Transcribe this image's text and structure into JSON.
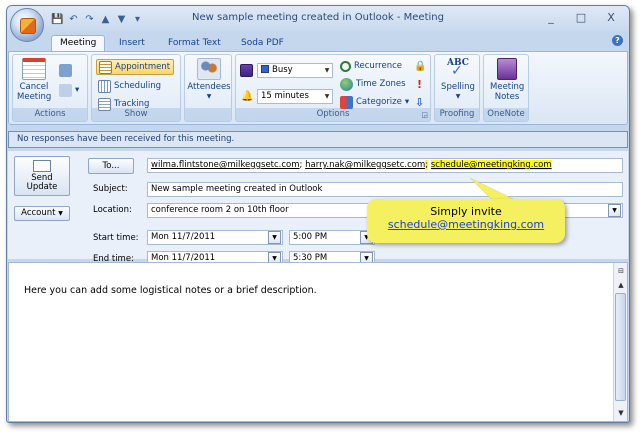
{
  "window": {
    "title": "New sample meeting created in Outlook - Meeting",
    "controls": [
      "_",
      "□",
      "X"
    ]
  },
  "tabs": [
    "Meeting",
    "Insert",
    "Format Text",
    "Soda PDF"
  ],
  "ribbon": {
    "actions": {
      "label": "Actions",
      "cancel": "Cancel Meeting"
    },
    "show": {
      "label": "Show",
      "appointment": "Appointment",
      "scheduling": "Scheduling",
      "tracking": "Tracking"
    },
    "attendees": {
      "label": "Attendees"
    },
    "options": {
      "label": "Options",
      "busy": "Busy",
      "reminder": "15 minutes",
      "recurrence": "Recurrence",
      "time_zones": "Time Zones",
      "categorize": "Categorize"
    },
    "proofing": {
      "label": "Proofing",
      "spelling": "Spelling",
      "abc": "ABC"
    },
    "onenote": {
      "label": "OneNote",
      "meeting_notes": "Meeting Notes"
    }
  },
  "infobar": "No responses have been received for this meeting.",
  "form": {
    "send_update": "Send Update",
    "account": "Account",
    "to_button": "To...",
    "recipients": {
      "r1": "wilma.flintstone@milkeggsetc.com",
      "sep1": ";",
      "r2": "harry.nak@milkeggsetc.com",
      "sep2": ";",
      "r3": "schedule@meetingking.com"
    },
    "subject_label": "Subject:",
    "subject": "New sample meeting created in Outlook",
    "location_label": "Location:",
    "location": "conference room 2 on 10th floor",
    "start_label": "Start time:",
    "start_date": "Mon 11/7/2011",
    "start_time": "5:00 PM",
    "end_label": "End time:",
    "end_date": "Mon 11/7/2011",
    "end_time": "5:30 PM"
  },
  "callout": {
    "line1": "Simply invite",
    "line2": "schedule@meetingking.com"
  },
  "body_text": "Here you can add some logistical notes or a brief description."
}
